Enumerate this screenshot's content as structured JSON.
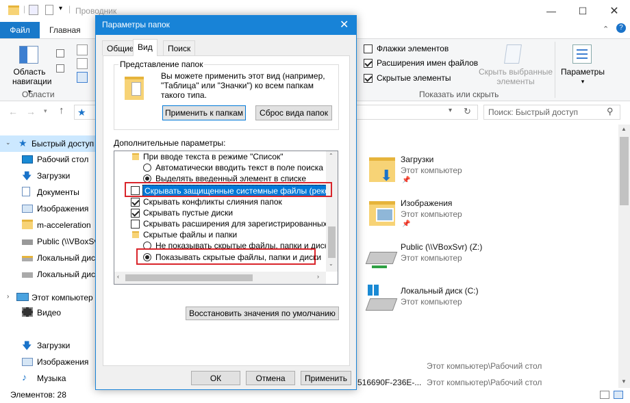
{
  "window": {
    "title": "Проводник"
  },
  "ribbon": {
    "tabs": [
      "Файл",
      "Главная"
    ],
    "areas_label": "Области",
    "nav_pane_label": [
      "Область",
      "навигации"
    ],
    "checks": [
      {
        "label": "Флажки элементов",
        "checked": false
      },
      {
        "label": "Расширения имен файлов",
        "checked": true
      },
      {
        "label": "Скрытые элементы",
        "checked": true
      }
    ],
    "hide_selected": [
      "Скрыть выбранные",
      "элементы"
    ],
    "show_hide_label": "Показать или скрыть",
    "params_label": "Параметры"
  },
  "search": {
    "placeholder": "Поиск: Быстрый доступ"
  },
  "nav": {
    "quick_access": "Быстрый доступ",
    "items": [
      "Рабочий стол",
      "Загрузки",
      "Документы",
      "Изображения",
      "m-acceleration",
      "Public (\\\\VBoxSvr)",
      "Локальный дис",
      "Локальный дис"
    ],
    "this_pc": "Этот компьютер",
    "pc_items": [
      "Видео",
      "Загрузки",
      "Изображения",
      "Музыка"
    ]
  },
  "tiles": [
    {
      "title": "Загрузки",
      "sub": "Этот компьютер"
    },
    {
      "title": "Изображения",
      "sub": "Этот компьютер"
    },
    {
      "title": "Public (\\\\VBoxSvr) (Z:)",
      "sub": "Этот компьютер"
    },
    {
      "title": "Локальный диск (C:)",
      "sub": "Этот компьютер"
    }
  ],
  "recent": [
    {
      "path": "Этот компьютер\\Рабочий стол"
    },
    {
      "name": "516690F-236E-...",
      "path": "Этот компьютер\\Рабочий стол"
    }
  ],
  "status": {
    "count": "Элементов: 28"
  },
  "dialog": {
    "title": "Параметры папок",
    "tabs": [
      "Общие",
      "Вид",
      "Поиск"
    ],
    "folder_view": {
      "legend": "Представление папок",
      "text": [
        "Вы можете применить этот вид (например,",
        "\"Таблица\" или \"Значки\") ко всем папкам",
        "такого типа."
      ],
      "apply": "Применить к папкам",
      "reset": "Сброс вида папок"
    },
    "advanced_label": "Дополнительные параметры:",
    "tree": [
      {
        "kind": "folder",
        "text": "При вводе текста в режиме \"Список\""
      },
      {
        "kind": "radio",
        "on": false,
        "text": "Автоматически вводить текст в поле поиска"
      },
      {
        "kind": "radio",
        "on": true,
        "text": "Выделять введенный элемент в списке"
      },
      {
        "kind": "check",
        "on": false,
        "text": "Скрывать защищенные системные файлы (рекомен"
      },
      {
        "kind": "check",
        "on": true,
        "text": "Скрывать конфликты слияния папок"
      },
      {
        "kind": "check",
        "on": true,
        "text": "Скрывать пустые диски"
      },
      {
        "kind": "check",
        "on": false,
        "text": "Скрывать расширения для зарегистрированных типо"
      },
      {
        "kind": "folder",
        "text": "Скрытые файлы и папки"
      },
      {
        "kind": "radio",
        "on": false,
        "text": "Не показывать скрытые файлы, папки и диски"
      },
      {
        "kind": "radio",
        "on": true,
        "text": "Показывать скрытые файлы, папки и диски"
      }
    ],
    "restore": "Восстановить значения по умолчанию",
    "ok": "ОК",
    "cancel": "Отмена",
    "apply": "Применить"
  }
}
